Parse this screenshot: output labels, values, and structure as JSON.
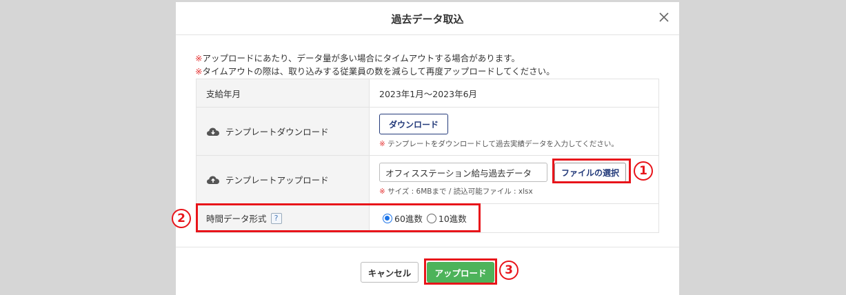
{
  "modal": {
    "title": "過去データ取込",
    "close_icon": "close-icon"
  },
  "notes": {
    "mark": "※",
    "line1": "アップロードにあたり、データ量が多い場合にタイムアウトする場合があります。",
    "line2": "タイムアウトの際は、取り込みする従業員の数を減らして再度アップロードしてください。"
  },
  "form": {
    "period": {
      "label": "支給年月",
      "value": "2023年1月～2023年6月"
    },
    "download": {
      "icon": "cloud-download-icon",
      "label": "テンプレートダウンロード",
      "button": "ダウンロード",
      "note_mark": "※",
      "note": " テンプレートをダウンロードして過去実績データを入力してください。"
    },
    "upload": {
      "icon": "cloud-upload-icon",
      "label": "テンプレートアップロード",
      "file_name": "オフィスステーション給与過去データ",
      "file_button": "ファイルの選択",
      "note_mark": "※",
      "note": " サイズ : 6MBまで / 読込可能ファイル : xlsx"
    },
    "time_format": {
      "label": "時間データ形式",
      "help": "?",
      "options": [
        {
          "label": "60進数",
          "checked": true
        },
        {
          "label": "10進数",
          "checked": false
        }
      ]
    }
  },
  "footer": {
    "cancel": "キャンセル",
    "upload": "アップロード"
  },
  "annotations": {
    "color": "#e8141a",
    "badge1": "1",
    "badge2": "2",
    "badge3": "3"
  },
  "colors": {
    "primary_text": "#233a7a",
    "upload_green": "#4db35a",
    "warning_red": "#e53333"
  }
}
